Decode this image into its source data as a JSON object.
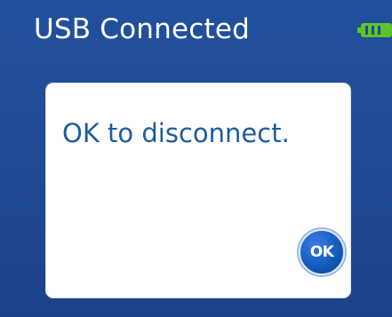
{
  "status_bar": {
    "title": "USB Connected",
    "battery_icon": "battery-icon"
  },
  "dialog": {
    "message": "OK to disconnect.",
    "ok_label": "OK"
  },
  "colors": {
    "background": "#1f4a95",
    "dialog_text": "#1d5c9d",
    "ok_button": "#145cbc",
    "battery": "#5cc52a"
  }
}
